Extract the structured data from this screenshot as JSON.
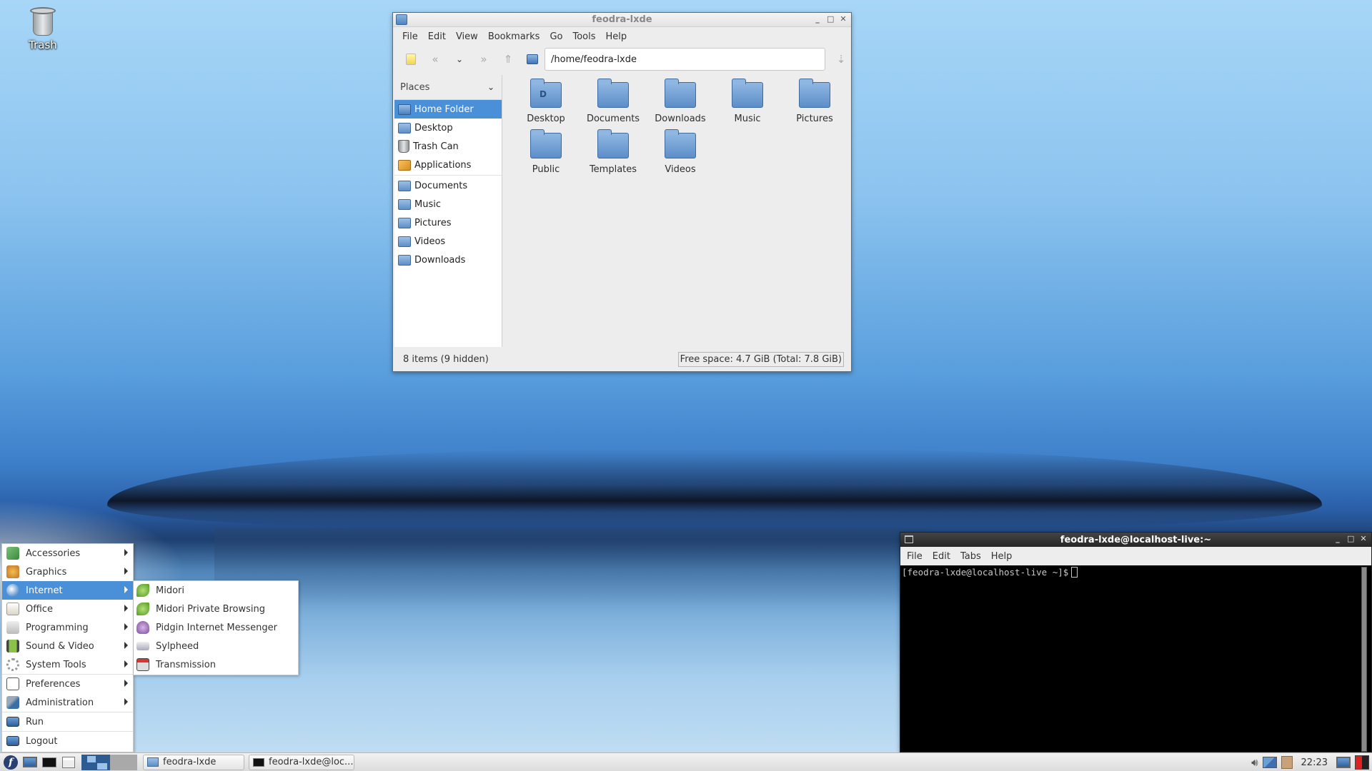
{
  "desktop": {
    "icons": [
      {
        "label": "Trash",
        "icon": "trash-icon"
      }
    ]
  },
  "file_manager": {
    "title": "feodra-lxde",
    "menu": [
      "File",
      "Edit",
      "View",
      "Bookmarks",
      "Go",
      "Tools",
      "Help"
    ],
    "toolbar": {
      "buttons": [
        "new-tab-icon",
        "back-icon",
        "history-dropdown-icon",
        "forward-icon",
        "up-icon",
        "home-icon"
      ],
      "address": "/home/feodra-lxde",
      "go_icon": "go-icon"
    },
    "sidebar": {
      "header": "Places",
      "items": [
        {
          "label": "Home Folder",
          "icon": "home-folder-icon",
          "active": true
        },
        {
          "label": "Desktop",
          "icon": "desktop-folder-icon"
        },
        {
          "label": "Trash Can",
          "icon": "trash-icon"
        },
        {
          "label": "Applications",
          "icon": "applications-icon"
        }
      ],
      "bookmarks": [
        {
          "label": "Documents",
          "icon": "folder-icon"
        },
        {
          "label": "Music",
          "icon": "folder-icon"
        },
        {
          "label": "Pictures",
          "icon": "folder-icon"
        },
        {
          "label": "Videos",
          "icon": "folder-icon"
        },
        {
          "label": "Downloads",
          "icon": "folder-icon"
        }
      ]
    },
    "files": [
      {
        "name": "Desktop"
      },
      {
        "name": "Documents"
      },
      {
        "name": "Downloads"
      },
      {
        "name": "Music"
      },
      {
        "name": "Pictures"
      },
      {
        "name": "Public"
      },
      {
        "name": "Templates"
      },
      {
        "name": "Videos"
      }
    ],
    "status": {
      "items": "8 items (9 hidden)",
      "free_space": "Free space: 4.7 GiB (Total: 7.8 GiB)"
    }
  },
  "start_menu": {
    "items": [
      {
        "label": "Accessories",
        "submenu": true
      },
      {
        "label": "Graphics",
        "submenu": true
      },
      {
        "label": "Internet",
        "submenu": true,
        "active": true
      },
      {
        "label": "Office",
        "submenu": true
      },
      {
        "label": "Programming",
        "submenu": true
      },
      {
        "label": "Sound & Video",
        "submenu": true
      },
      {
        "label": "System Tools",
        "submenu": true
      },
      {
        "label": "Preferences",
        "submenu": true
      },
      {
        "label": "Administration",
        "submenu": true
      },
      {
        "label": "Run"
      },
      {
        "label": "Logout"
      }
    ],
    "internet_submenu": [
      {
        "label": "Midori"
      },
      {
        "label": "Midori Private Browsing"
      },
      {
        "label": "Pidgin Internet Messenger"
      },
      {
        "label": "Sylpheed"
      },
      {
        "label": "Transmission"
      }
    ]
  },
  "terminal": {
    "title": "feodra-lxde@localhost-live:~",
    "menu": [
      "File",
      "Edit",
      "Tabs",
      "Help"
    ],
    "prompt": "[feodra-lxde@localhost-live ~]$"
  },
  "taskbar": {
    "tasks": [
      {
        "label": "feodra-lxde"
      },
      {
        "label": "feodra-lxde@loc..."
      }
    ],
    "clock": "22:23"
  },
  "colors": {
    "accent": "#4a90d9",
    "terminal_bg": "#000000"
  }
}
